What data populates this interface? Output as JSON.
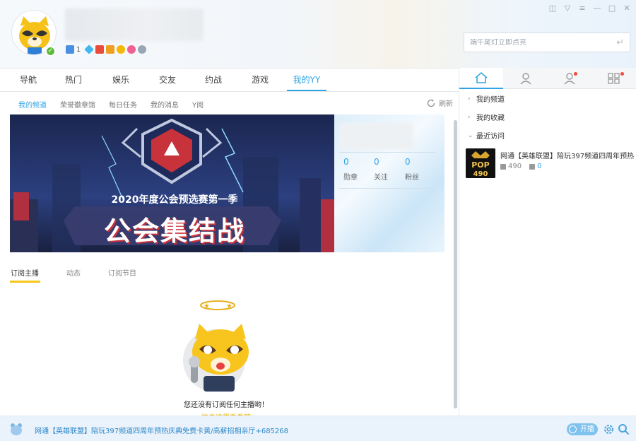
{
  "header": {
    "search_placeholder": "端午尾灯立即点亮",
    "badge_count": "1"
  },
  "main_nav": {
    "tabs": [
      {
        "label": "导航",
        "active": false
      },
      {
        "label": "热门",
        "active": false
      },
      {
        "label": "娱乐",
        "active": false
      },
      {
        "label": "交友",
        "active": false
      },
      {
        "label": "约战",
        "active": false
      },
      {
        "label": "游戏",
        "active": false
      },
      {
        "label": "我的YY",
        "active": true
      }
    ]
  },
  "sub_nav": {
    "items": [
      {
        "label": "我的频道",
        "active": true
      },
      {
        "label": "荣誉徽章馆",
        "active": false
      },
      {
        "label": "每日任务",
        "active": false
      },
      {
        "label": "我的消息",
        "active": false
      },
      {
        "label": "Y阅",
        "active": false
      }
    ],
    "refresh_label": "刷新"
  },
  "banner": {
    "line1": "2020年度公会预选赛第一季",
    "line2": "公会集结战"
  },
  "profile_card": {
    "stats": [
      {
        "value": "0",
        "label": "勋章"
      },
      {
        "value": "0",
        "label": "关注"
      },
      {
        "value": "0",
        "label": "粉丝"
      }
    ]
  },
  "subscription_tabs": [
    {
      "label": "订阅主播",
      "active": true
    },
    {
      "label": "动态",
      "active": false
    },
    {
      "label": "订阅节目",
      "active": false
    }
  ],
  "empty_state": {
    "message": "您还没有订阅任何主播哟！",
    "link": "快去这里看看吧"
  },
  "right_panel": {
    "tabs": [
      "home-icon",
      "user-icon",
      "friends-icon",
      "apps-icon"
    ],
    "sections": [
      {
        "label": "我的频道",
        "expanded": false
      },
      {
        "label": "我的收藏",
        "expanded": false
      },
      {
        "label": "最近访问",
        "expanded": true
      }
    ],
    "recent": {
      "title": "网通【英雄联盟】陪玩397频道四周年预热",
      "thumb_text": "POP",
      "thumb_num": "490",
      "viewers": "490",
      "online": "0"
    }
  },
  "statusbar": {
    "text": "网通【英雄联盟】陪玩397频道四周年预热庆典免费卡黄/高薪招相亲厅+685268",
    "live_label": "开播"
  },
  "colors": {
    "accent": "#32a4e4",
    "highlight": "#f5c518"
  }
}
